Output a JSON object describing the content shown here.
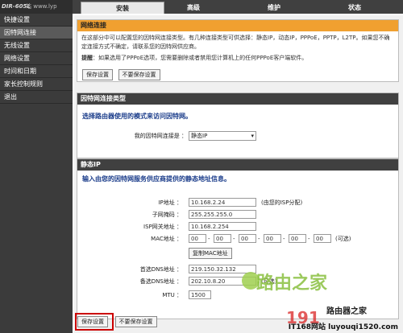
{
  "header": {
    "logo": "DIR-605L",
    "watermark_top": "站 www.lyp",
    "tabs": [
      "安装",
      "高级",
      "维护",
      "状态"
    ],
    "active_tab": 0
  },
  "sidebar": {
    "items": [
      "快捷设置",
      "因特网连接",
      "无线设置",
      "网络设置",
      "时间和日期",
      "家长控制规则",
      "退出"
    ],
    "active_index": 1
  },
  "internet": {
    "title": "网络连接",
    "note1": "在这部分中可以配置您的因特网连接类型。有几种连接类型可供选择：静态IP，动态IP，PPPoE，PPTP，L2TP。如果您不确定连接方式不确定，请联系您的因特网供应商。",
    "note2_bold": "提醒",
    "note2": "：如果选用了PPPoE选项，您需要删除或者禁用您计算机上的任何PPPoE客户端软件。",
    "save_btn": "保存设置",
    "nosave_btn": "不要保存设置"
  },
  "conn_type": {
    "title": "因特网连接类型",
    "subtitle": "选择路由器使用的模式来访问因特网。",
    "label": "我的因特网连接是 ：",
    "value": "静态IP"
  },
  "static_ip": {
    "title": "静态IP",
    "subtitle": "输入由您的因特网服务供应商提供的静态地址信息。",
    "fields": [
      {
        "label": "IP地址 ：",
        "value": "10.168.2.24",
        "hint": "(由您的ISP分配)"
      },
      {
        "label": "子网掩码 ：",
        "value": "255.255.255.0",
        "hint": ""
      },
      {
        "label": "ISP网关地址 ：",
        "value": "10.168.2.254",
        "hint": ""
      }
    ],
    "mac_label": "MAC地址 ：",
    "mac_values": [
      "00",
      "00",
      "00",
      "00",
      "00",
      "00"
    ],
    "mac_hint": "(可选)",
    "clone_btn": "复制MAC地址",
    "dns1_label": "首选DNS地址 ：",
    "dns1_value": "219.150.32.132",
    "dns2_label": "备选DNS地址 ：",
    "dns2_value": "202.10.8.20",
    "dns2_hint": "(可选)",
    "mtu_label": "MTU ：",
    "mtu_value": "1500"
  },
  "bottom": {
    "save_btn": "保存设置",
    "nosave_btn": "不要保存设置"
  },
  "watermarks": {
    "router_home": "路由之家",
    "site_num": "191",
    "router_home2": "路由器之家",
    "it168": "IT168网站 luyouqi1520.com"
  }
}
